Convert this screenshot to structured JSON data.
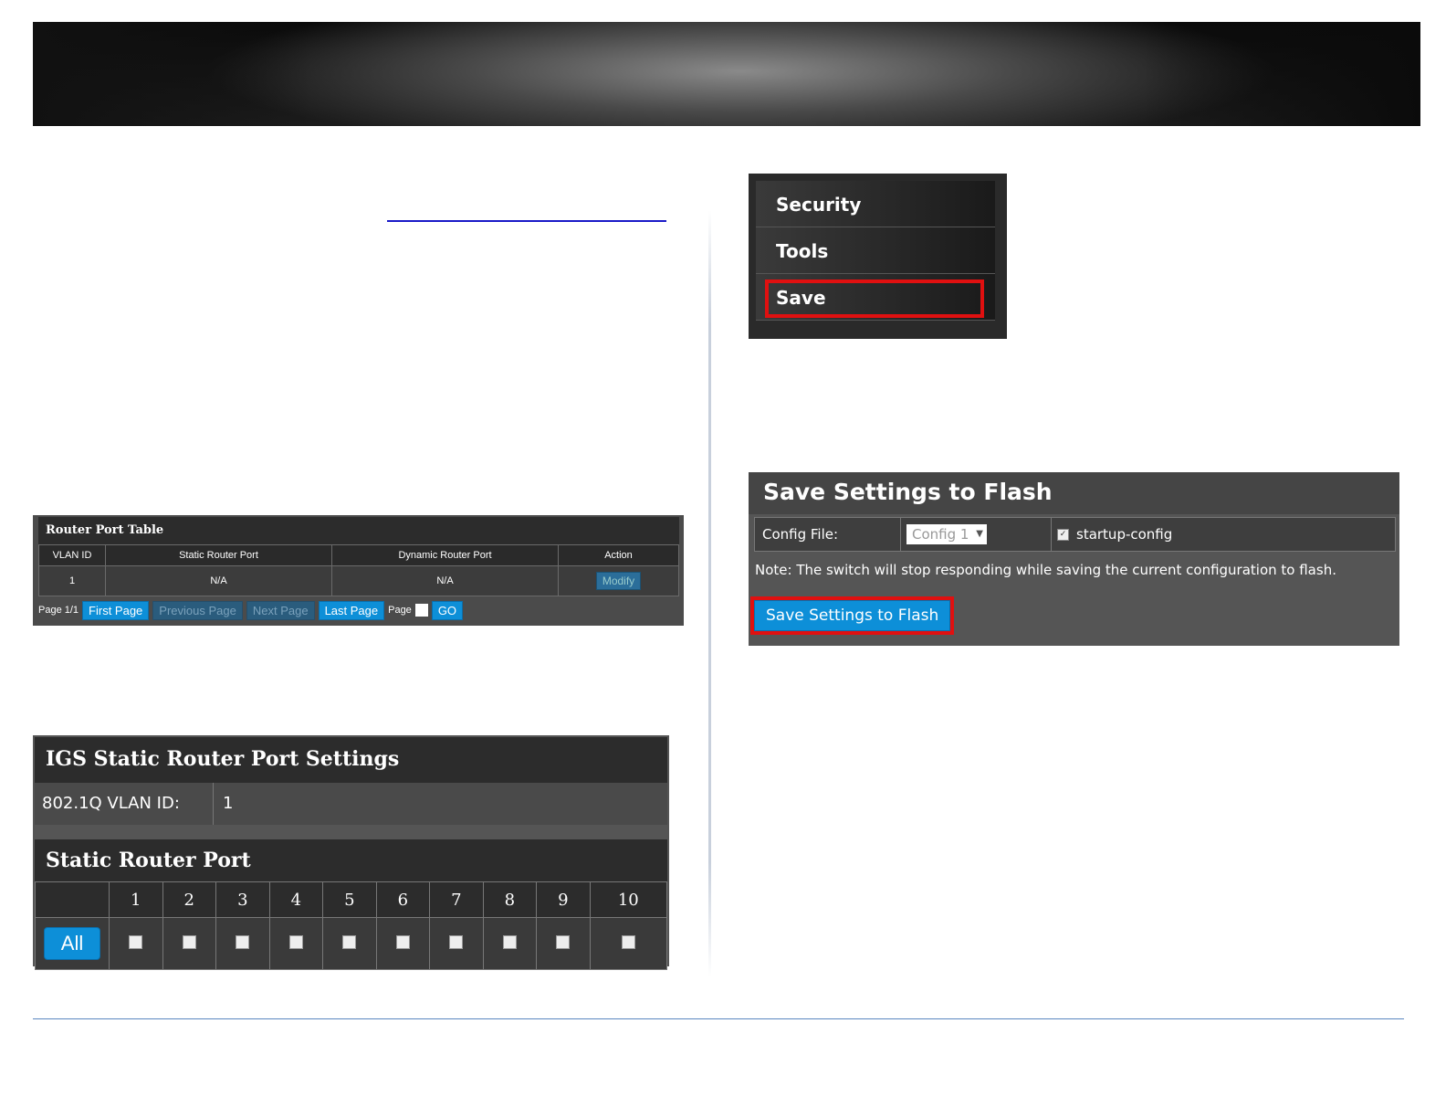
{
  "router_port_table": {
    "title": "Router Port Table",
    "columns": [
      "VLAN ID",
      "Static Router Port",
      "Dynamic Router Port",
      "Action"
    ],
    "row": {
      "vlan_id": "1",
      "static": "N/A",
      "dynamic": "N/A",
      "action": "Modify"
    },
    "pager": {
      "page_info": "Page 1/1",
      "first": "First Page",
      "previous": "Previous Page",
      "next": "Next Page",
      "last": "Last Page",
      "page_label": "Page",
      "go": "GO"
    }
  },
  "igs": {
    "title": "IGS Static Router Port Settings",
    "vlan_label": "802.1Q VLAN ID:",
    "vlan_value": "1",
    "static_title": "Static Router Port",
    "all_label": "All",
    "ports": [
      "1",
      "2",
      "3",
      "4",
      "5",
      "6",
      "7",
      "8",
      "9",
      "10"
    ]
  },
  "menu": {
    "items": [
      "Security",
      "Tools",
      "Save"
    ],
    "highlighted": "Save"
  },
  "save_flash": {
    "title": "Save Settings to Flash",
    "config_label": "Config File:",
    "config_value": "Config 1",
    "checkbox_label": "startup-config",
    "note": "Note: The switch will stop responding while saving the current configuration to flash.",
    "button": "Save Settings to Flash"
  },
  "colors": {
    "highlight": "#e01010",
    "button_blue": "#0d8fd8",
    "panel": "#555555"
  }
}
